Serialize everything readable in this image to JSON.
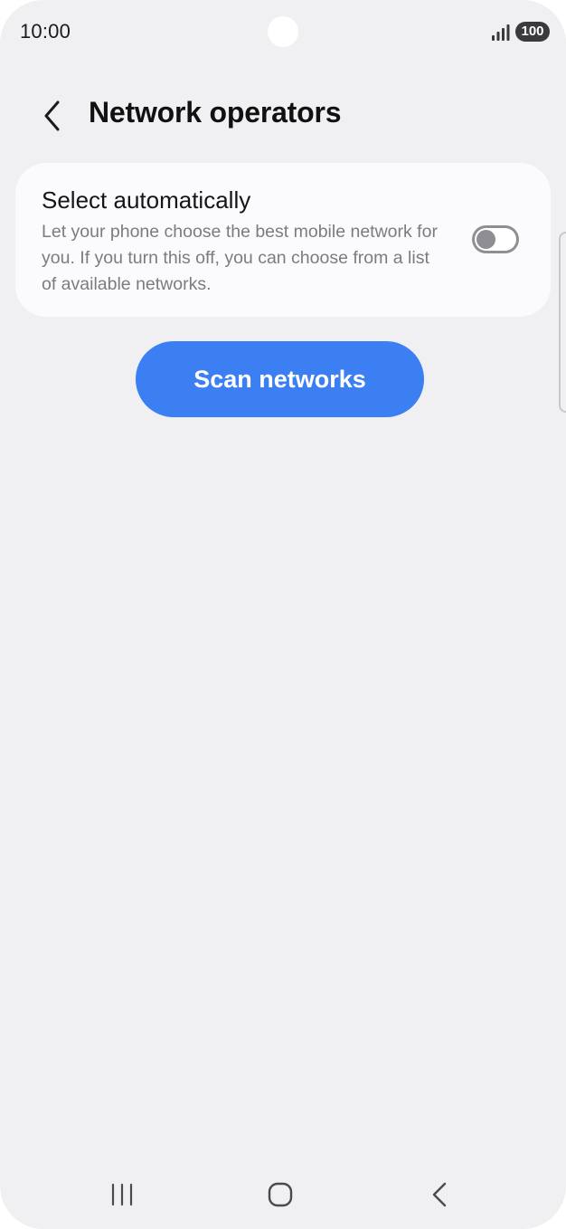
{
  "status_bar": {
    "time": "10:00",
    "battery": "100",
    "icons": [
      "signal-icon",
      "battery-icon"
    ]
  },
  "header": {
    "title": "Network operators",
    "back_icon": "chevron-left-icon"
  },
  "auto_select": {
    "title": "Select automatically",
    "description": "Let your phone choose the best mobile network for you. If you turn this off, you can choose from a list of available networks.",
    "enabled": false
  },
  "actions": {
    "scan_label": "Scan networks"
  },
  "navigation": {
    "items": [
      "recents-icon",
      "home-icon",
      "back-icon"
    ]
  },
  "colors": {
    "background": "#f0f0f3",
    "card": "#fbfbfd",
    "accent": "#3b7ff3",
    "toggle_off": "#8e8e93"
  }
}
